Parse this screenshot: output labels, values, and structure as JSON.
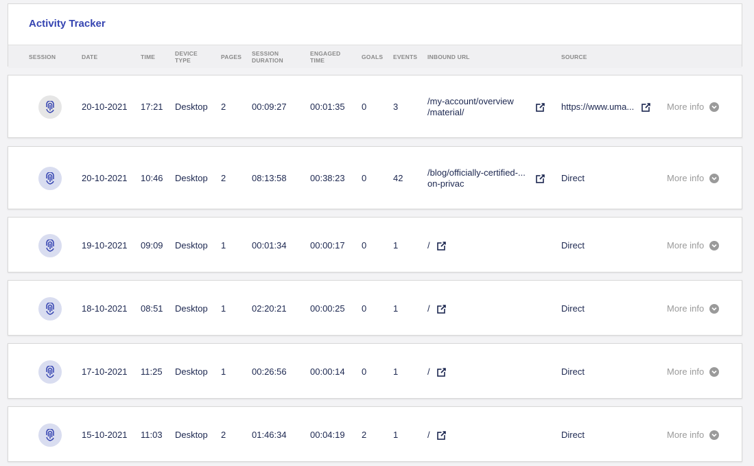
{
  "header": {
    "title": "Activity Tracker"
  },
  "columns": [
    {
      "l1": "SESSION",
      "l2": ""
    },
    {
      "l1": "DATE",
      "l2": ""
    },
    {
      "l1": "TIME",
      "l2": ""
    },
    {
      "l1": "DEVICE",
      "l2": "TYPE"
    },
    {
      "l1": "PAGES",
      "l2": ""
    },
    {
      "l1": "SESSION",
      "l2": "DURATION"
    },
    {
      "l1": "ENGAGED",
      "l2": "TIME"
    },
    {
      "l1": "GOALS",
      "l2": ""
    },
    {
      "l1": "EVENTS",
      "l2": ""
    },
    {
      "l1": "INBOUND URL",
      "l2": ""
    },
    {
      "l1": "SOURCE",
      "l2": ""
    }
  ],
  "more_info_label": "More info",
  "colors": {
    "accent": "#3544b1",
    "text": "#1b264f",
    "muted": "#9a9a9a",
    "avatar_bg": "#d9ddf0"
  },
  "rows": [
    {
      "session_icon": "fingerprint-icon",
      "date": "20-10-2021",
      "time": "17:21",
      "device": "Desktop",
      "pages": "2",
      "duration": "00:09:27",
      "engaged": "00:01:35",
      "goals": "0",
      "events": "3",
      "url1": "/my-account/overview",
      "url2": "/material/",
      "source": "https://www.uma..."
    },
    {
      "session_icon": "fingerprint-icon",
      "date": "20-10-2021",
      "time": "10:46",
      "device": "Desktop",
      "pages": "2",
      "duration": "08:13:58",
      "engaged": "00:38:23",
      "goals": "0",
      "events": "42",
      "url1": "/blog/officially-certified-...",
      "url2": "on-privac",
      "source": "Direct"
    },
    {
      "session_icon": "fingerprint-icon",
      "date": "19-10-2021",
      "time": "09:09",
      "device": "Desktop",
      "pages": "1",
      "duration": "00:01:34",
      "engaged": "00:00:17",
      "goals": "0",
      "events": "1",
      "url1": "/",
      "url2": "",
      "source": "Direct"
    },
    {
      "session_icon": "fingerprint-icon",
      "date": "18-10-2021",
      "time": "08:51",
      "device": "Desktop",
      "pages": "1",
      "duration": "02:20:21",
      "engaged": "00:00:25",
      "goals": "0",
      "events": "1",
      "url1": "/",
      "url2": "",
      "source": "Direct"
    },
    {
      "session_icon": "fingerprint-icon",
      "date": "17-10-2021",
      "time": "11:25",
      "device": "Desktop",
      "pages": "1",
      "duration": "00:26:56",
      "engaged": "00:00:14",
      "goals": "0",
      "events": "1",
      "url1": "/",
      "url2": "",
      "source": "Direct"
    },
    {
      "session_icon": "fingerprint-icon",
      "date": "15-10-2021",
      "time": "11:03",
      "device": "Desktop",
      "pages": "2",
      "duration": "01:46:34",
      "engaged": "00:04:19",
      "goals": "2",
      "events": "1",
      "url1": "/",
      "url2": "",
      "source": "Direct"
    }
  ]
}
